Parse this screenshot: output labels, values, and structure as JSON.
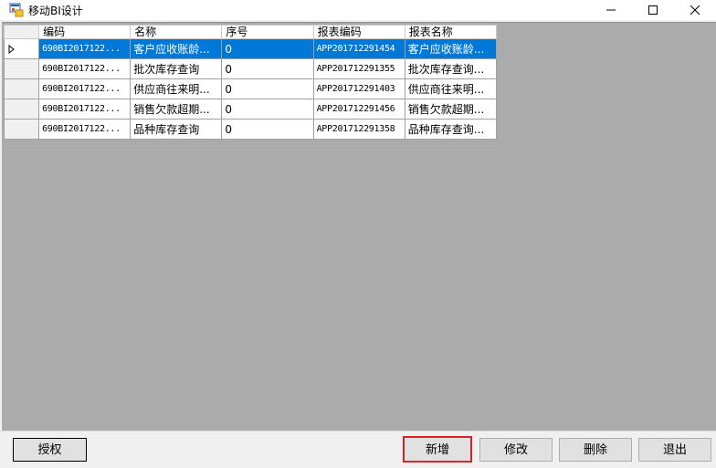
{
  "window": {
    "title": "移动BI设计",
    "icon": "app-window-icon"
  },
  "grid": {
    "columns": [
      "编码",
      "名称",
      "序号",
      "报表编码",
      "报表名称"
    ],
    "rows": [
      [
        "690BI2017122...",
        "客户应收账龄...",
        "0",
        "APP201712291454",
        "客户应收账龄..."
      ],
      [
        "690BI2017122...",
        "批次库存查询",
        "0",
        "APP201712291355",
        "批次库存查询..."
      ],
      [
        "690BI2017122...",
        "供应商往来明...",
        "0",
        "APP201712291403",
        "供应商往来明..."
      ],
      [
        "690BI2017122...",
        "销售欠款超期...",
        "0",
        "APP201712291456",
        "销售欠款超期..."
      ],
      [
        "690BI2017122...",
        "品种库存查询",
        "0",
        "APP201712291358",
        "品种库存查询..."
      ]
    ],
    "selected_row": 0
  },
  "buttons": {
    "authorize": "授权",
    "add": "新增",
    "edit": "修改",
    "delete": "删除",
    "exit": "退出"
  },
  "colors": {
    "selection": "#0078d7",
    "highlight_border": "#e02020",
    "client_background": "#ababab"
  }
}
